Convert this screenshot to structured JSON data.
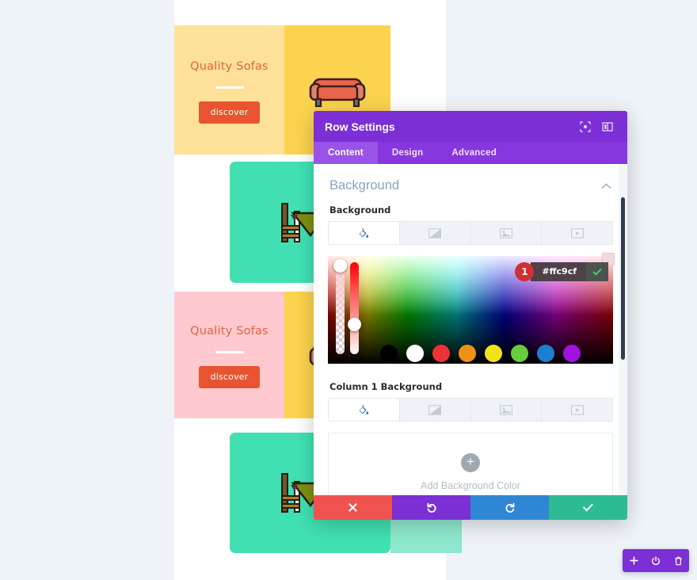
{
  "page": {
    "rows": [
      {
        "title": "Quality Sofas",
        "button": "discover",
        "art": "sofa-illustration",
        "text_bg": "#fde198",
        "art_bg": "#fcd34e"
      },
      {
        "title": "",
        "button": "",
        "art": "table-chairs-illustration",
        "text_bg": "",
        "art_bg": "#41e0b3"
      },
      {
        "title": "Quality Sofas",
        "button": "discover",
        "art": "sofa-illustration",
        "text_bg": "#ffc9cf",
        "art_bg": "#fcd34e"
      },
      {
        "title": "",
        "button": "",
        "art": "table-chairs-illustration",
        "text_bg": "",
        "art_bg": "#41e0b3"
      }
    ]
  },
  "modal": {
    "title": "Row Settings",
    "header_icons": [
      {
        "name": "focus-icon"
      },
      {
        "name": "panel-layout-icon"
      }
    ],
    "tabs": [
      {
        "label": "Content",
        "active": true
      },
      {
        "label": "Design",
        "active": false
      },
      {
        "label": "Advanced",
        "active": false
      }
    ],
    "section": {
      "title": "Background",
      "collapse_icon": "chevron-up-icon"
    },
    "background_field": {
      "label": "Background",
      "types": [
        {
          "name": "color-fill-icon",
          "active": true
        },
        {
          "name": "gradient-icon",
          "active": false
        },
        {
          "name": "image-icon",
          "active": false
        },
        {
          "name": "video-icon",
          "active": false
        }
      ]
    },
    "color_picker": {
      "hex_value": "#ffc9cf",
      "step_badge": "1",
      "confirm_icon": "check-icon",
      "alpha_slider": "alpha-slider",
      "hue_slider": "hue-slider",
      "swatches": [
        "#000000",
        "#ffffff",
        "#ed3237",
        "#ef9116",
        "#f1e317",
        "#6bcb3e",
        "#1d7fd0",
        "#a013dd"
      ]
    },
    "column_field": {
      "label": "Column 1 Background",
      "types": [
        {
          "name": "color-fill-icon",
          "active": true
        },
        {
          "name": "gradient-icon",
          "active": false
        },
        {
          "name": "image-icon",
          "active": false
        },
        {
          "name": "video-icon",
          "active": false
        }
      ],
      "add_label": "Add Background Color",
      "add_icon": "plus-icon"
    },
    "footer": [
      {
        "name": "cancel-button",
        "icon": "x-icon",
        "color": "#ef5350"
      },
      {
        "name": "undo-button",
        "icon": "undo-icon",
        "color": "#7b2fd4"
      },
      {
        "name": "redo-button",
        "icon": "redo-icon",
        "color": "#2e86d4"
      },
      {
        "name": "save-button",
        "icon": "check-icon",
        "color": "#2dbb92"
      }
    ]
  },
  "toolbar": {
    "buttons": [
      {
        "name": "add-section-button",
        "icon": "plus-icon"
      },
      {
        "name": "toggle-builder-button",
        "icon": "power-icon"
      },
      {
        "name": "delete-button",
        "icon": "trash-icon"
      }
    ]
  }
}
